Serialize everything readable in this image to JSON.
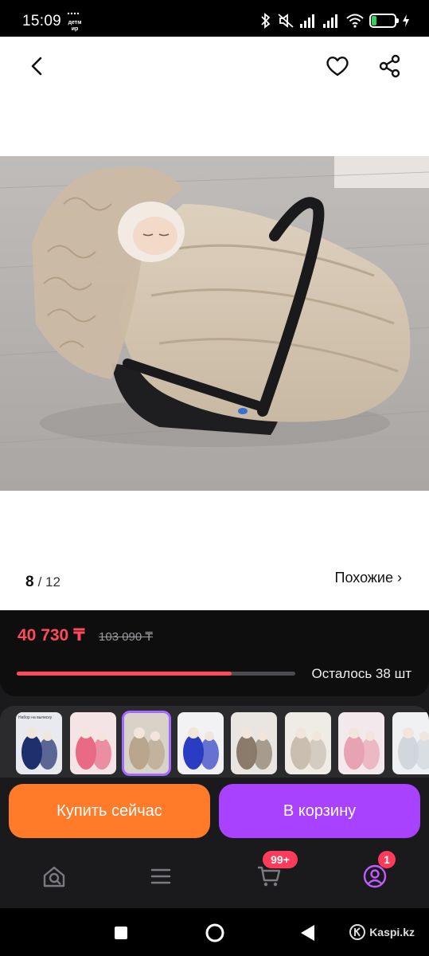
{
  "status_bar": {
    "time": "15:09",
    "app_icon_text": "детмир",
    "battery": "25",
    "battery_level": 0.25
  },
  "header": {
    "back_icon": "chevron-left-icon",
    "favorite_icon": "heart-icon",
    "share_icon": "share-icon"
  },
  "gallery": {
    "current": "8",
    "total": "/ 12",
    "similar_label": "Похожие ›"
  },
  "price": {
    "current": "40 730 ₸",
    "old": "103 090 ₸",
    "stock_label": "Осталось 38 шт",
    "stock_fraction": 0.77
  },
  "thumbnails": [
    {
      "label": "Набор на выписку",
      "bg": "#e8eaf0",
      "accent": "#1e2f6e"
    },
    {
      "label": "",
      "bg": "#f4e4e6",
      "accent": "#e86a84"
    },
    {
      "label": "",
      "bg": "#d9d2c8",
      "accent": "#b8a58c",
      "selected": true
    },
    {
      "label": "",
      "bg": "#f2f2f4",
      "accent": "#2a3cc2"
    },
    {
      "label": "",
      "bg": "#e9e6e2",
      "accent": "#8a7b6a"
    },
    {
      "label": "",
      "bg": "#efece6",
      "accent": "#c9beb0"
    },
    {
      "label": "",
      "bg": "#f3e9ec",
      "accent": "#e8a3b3"
    },
    {
      "label": "",
      "bg": "#eef0f2",
      "accent": "#cfd6dc"
    }
  ],
  "actions": {
    "buy_now": "Купить сейчас",
    "add_to_cart": "В корзину"
  },
  "tab_bar": {
    "home_icon": "home-search-icon",
    "menu_icon": "menu-icon",
    "cart_icon": "cart-icon",
    "cart_badge": "99+",
    "profile_icon": "profile-icon",
    "profile_badge": "1"
  },
  "watermark": "Kaspi.kz",
  "colors": {
    "accent_price": "#ff4a5c",
    "buy_button": "#ff7a29",
    "cart_button": "#a842ff",
    "selected_thumb": "#a26bff",
    "profile_icon": "#c15cff"
  }
}
